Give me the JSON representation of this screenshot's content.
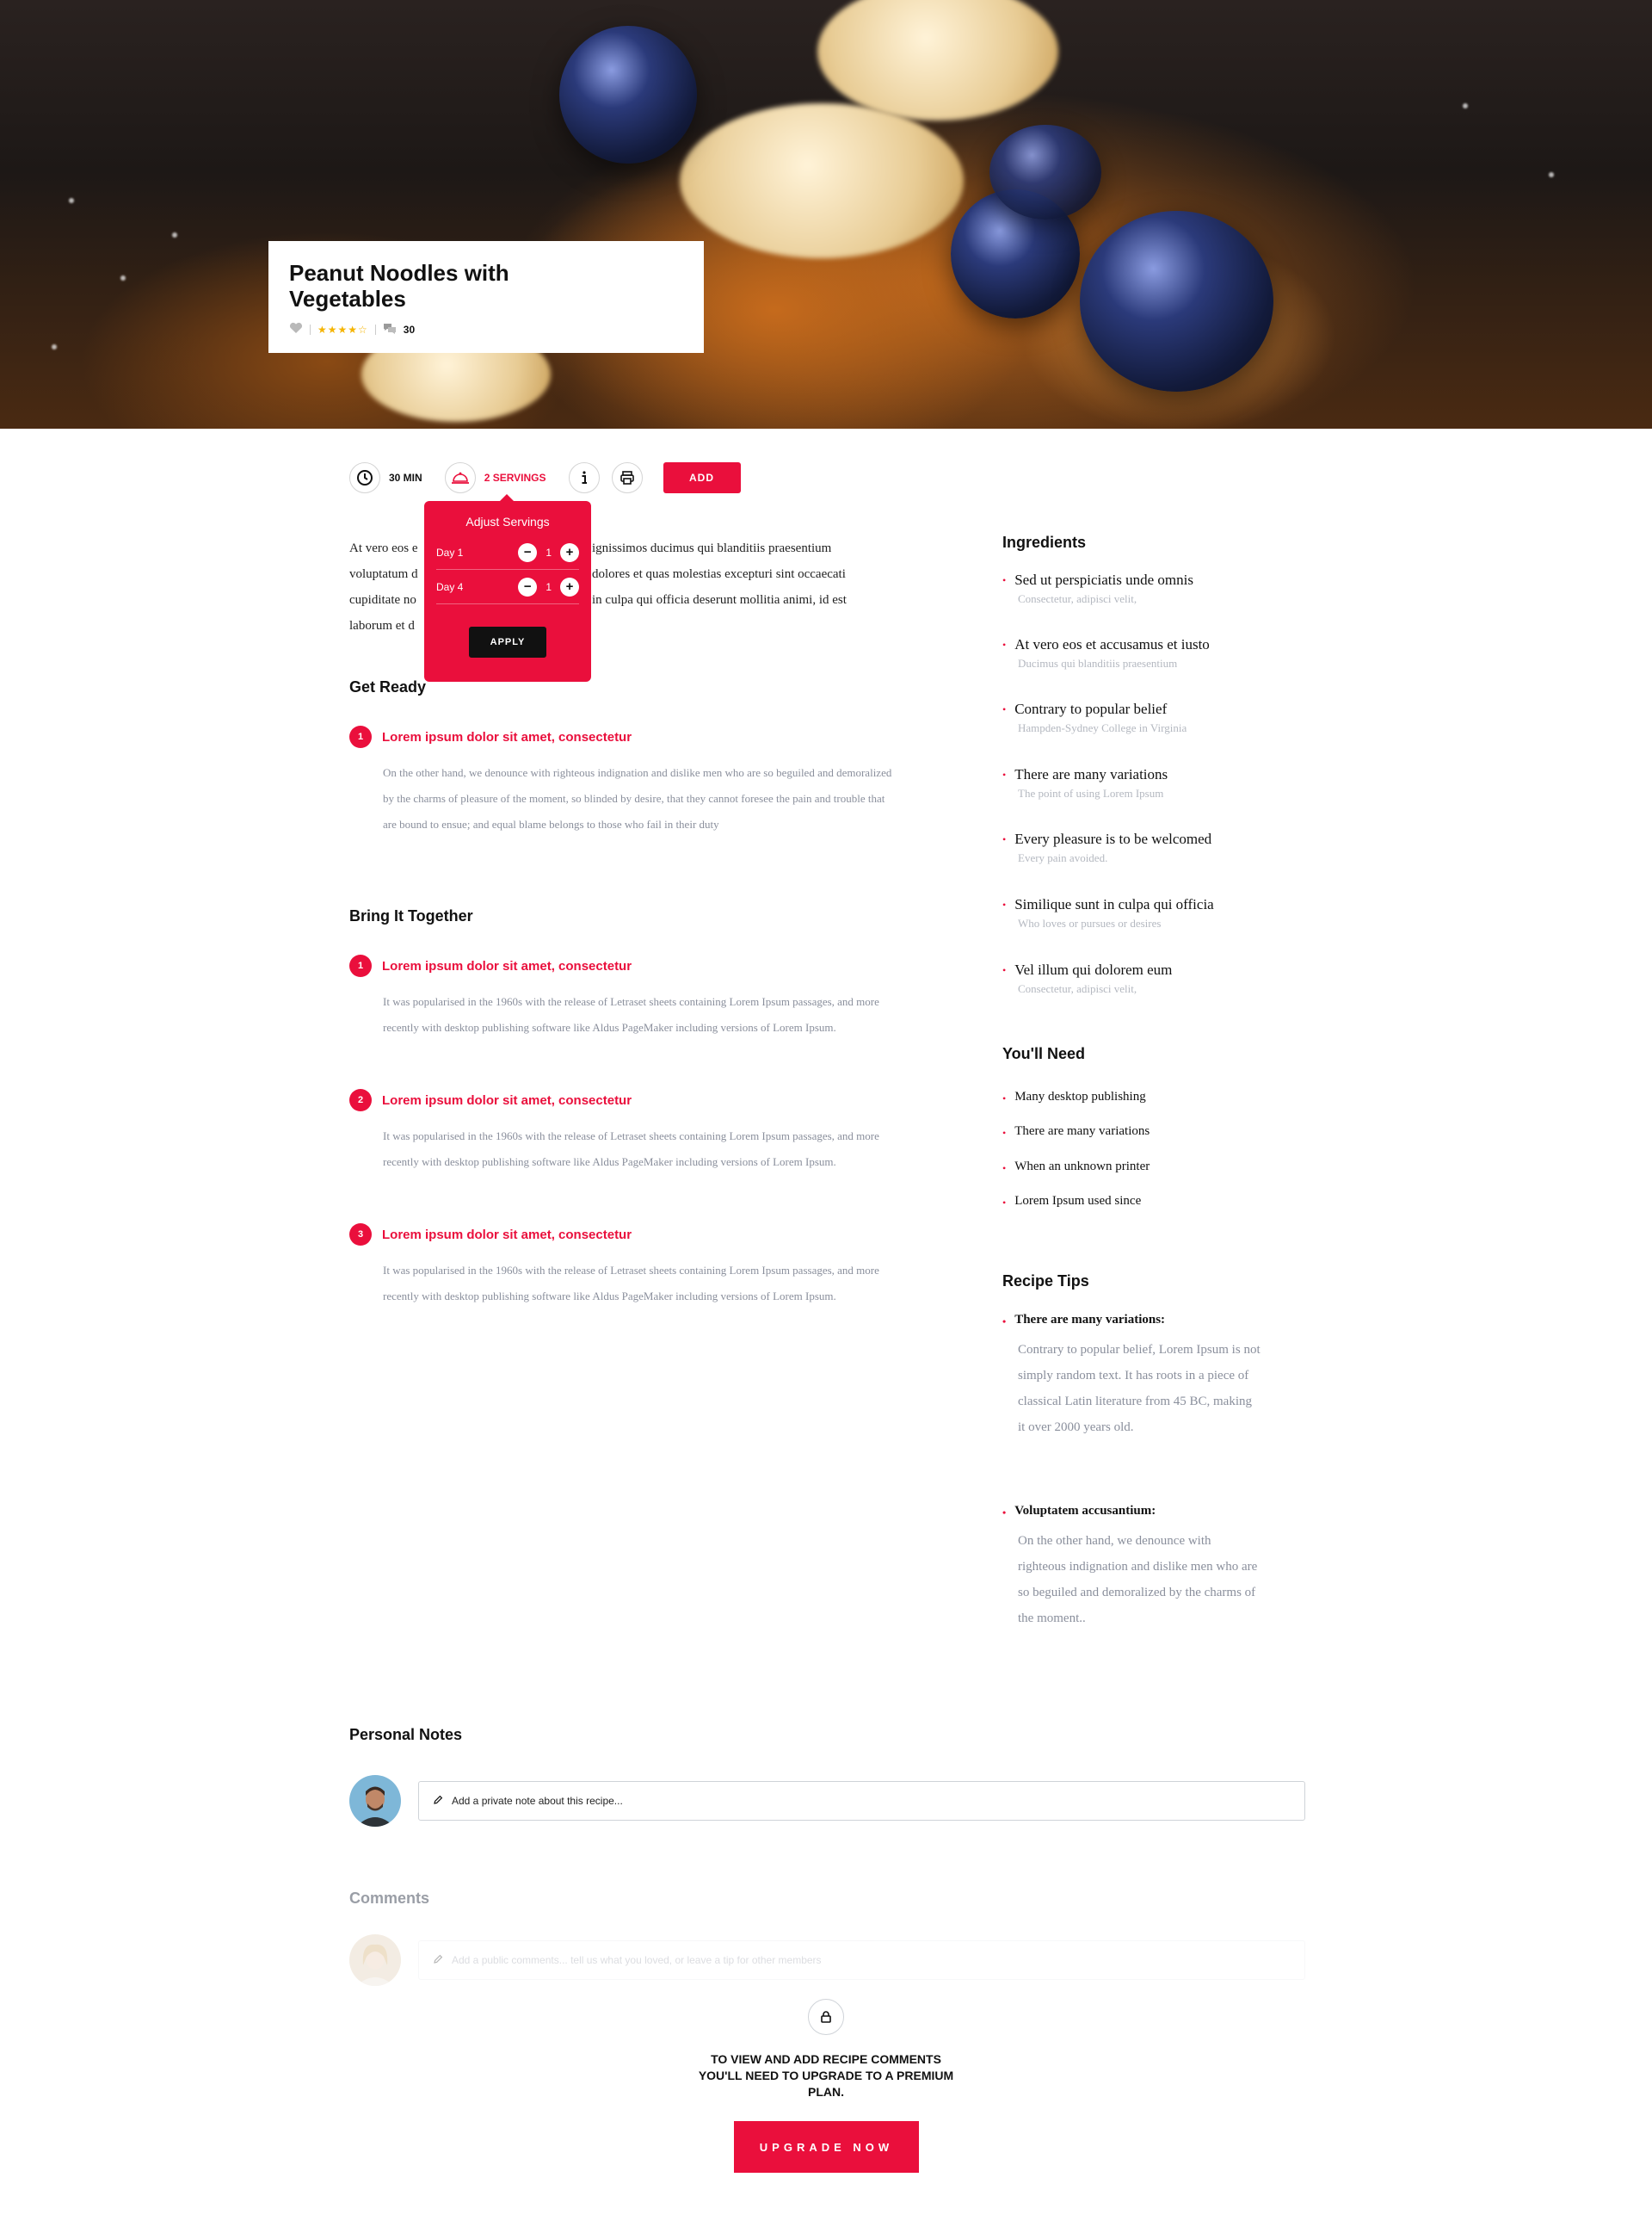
{
  "recipe": {
    "title": "Peanut Noodles with Vegetables",
    "rating_stars": "★★★★☆",
    "rating": 4,
    "comment_count": "30"
  },
  "toolbar": {
    "time": "30 MIN",
    "servings": "2 SERVINGS",
    "add_label": "ADD"
  },
  "servings_popup": {
    "title": "Adjust Servings",
    "rows": [
      {
        "label": "Day 1",
        "value": "1"
      },
      {
        "label": "Day 4",
        "value": "1"
      }
    ],
    "apply_label": "APPLY"
  },
  "intro": {
    "left_lines": [
      "At vero eos e",
      "voluptatum d",
      "cupiditate no",
      "laborum et d"
    ],
    "right_lines": [
      "ignissimos ducimus qui blanditiis praesentium",
      "dolores et quas molestias excepturi sint occaecati",
      "in culpa qui officia deserunt mollitia animi, id est",
      ""
    ]
  },
  "get_ready": {
    "title": "Get Ready",
    "steps": [
      {
        "number": "1",
        "title": "Lorem ipsum dolor sit amet, consectetur",
        "body": "On the other hand, we denounce with righteous indignation and dislike men who are so beguiled and demoralized by the charms of pleasure of the moment, so blinded by desire, that they cannot foresee the pain and trouble that are bound to ensue; and equal blame belongs to those who fail in their duty"
      }
    ]
  },
  "bring_together": {
    "title": "Bring It Together",
    "steps": [
      {
        "number": "1",
        "title": "Lorem ipsum dolor sit amet, consectetur",
        "body": " It was popularised in the 1960s with the release of Letraset sheets containing Lorem Ipsum passages, and more recently with desktop publishing software like Aldus PageMaker including versions of Lorem Ipsum."
      },
      {
        "number": "2",
        "title": "Lorem ipsum dolor sit amet, consectetur",
        "body": " It was popularised in the 1960s with the release of Letraset sheets containing Lorem Ipsum passages, and more recently with desktop publishing software like Aldus PageMaker including versions of Lorem Ipsum."
      },
      {
        "number": "3",
        "title": "Lorem ipsum dolor sit amet, consectetur",
        "body": " It was popularised in the 1960s with the release of Letraset sheets containing Lorem Ipsum passages, and more recently with desktop publishing software like Aldus PageMaker including versions of Lorem Ipsum."
      }
    ]
  },
  "ingredients": {
    "title": "Ingredients",
    "items": [
      {
        "name": "Sed ut perspiciatis unde omnis",
        "note": "Consectetur, adipisci velit,"
      },
      {
        "name": "At vero eos et accusamus et iusto",
        "note": "Ducimus qui blanditiis praesentium"
      },
      {
        "name": "Contrary to popular belief",
        "note": "Hampden-Sydney College in Virginia"
      },
      {
        "name": "There are many variations",
        "note": "The point of using Lorem Ipsum"
      },
      {
        "name": "Every pleasure is to be welcomed",
        "note": "Every pain avoided."
      },
      {
        "name": "Similique sunt in culpa qui officia",
        "note": "Who loves or pursues or desires"
      },
      {
        "name": "Vel illum qui dolorem eum",
        "note": "Consectetur, adipisci velit,"
      }
    ]
  },
  "youll_need": {
    "title": "You'll Need",
    "items": [
      "Many desktop publishing",
      "There are many variations",
      "When an unknown printer",
      "Lorem Ipsum used since"
    ]
  },
  "tips": {
    "title": "Recipe Tips",
    "items": [
      {
        "title": "There are many variations:",
        "body": "Contrary to popular belief, Lorem Ipsum is not simply random text. It has roots in a piece of classical Latin literature from 45 BC, making it over 2000 years old."
      },
      {
        "title": "Voluptatem accusantium:",
        "body": "On the other hand, we denounce with righteous indignation and dislike men who are so beguiled and demoralized by the charms of the moment.."
      }
    ]
  },
  "notes": {
    "title": "Personal Notes",
    "placeholder": "Add a private note about this recipe..."
  },
  "comments": {
    "title": "Comments",
    "placeholder": "Add a public comments... tell us what you loved, or leave a tip for other members",
    "locked_message": "TO VIEW AND ADD RECIPE COMMENTS YOU'LL NEED TO UPGRADE TO A PREMIUM PLAN.",
    "upgrade_label": "UPGRADE NOW"
  },
  "colors": {
    "accent": "#ea0f3c",
    "muted_text": "#8a8f9c",
    "star": "#f5b400"
  }
}
